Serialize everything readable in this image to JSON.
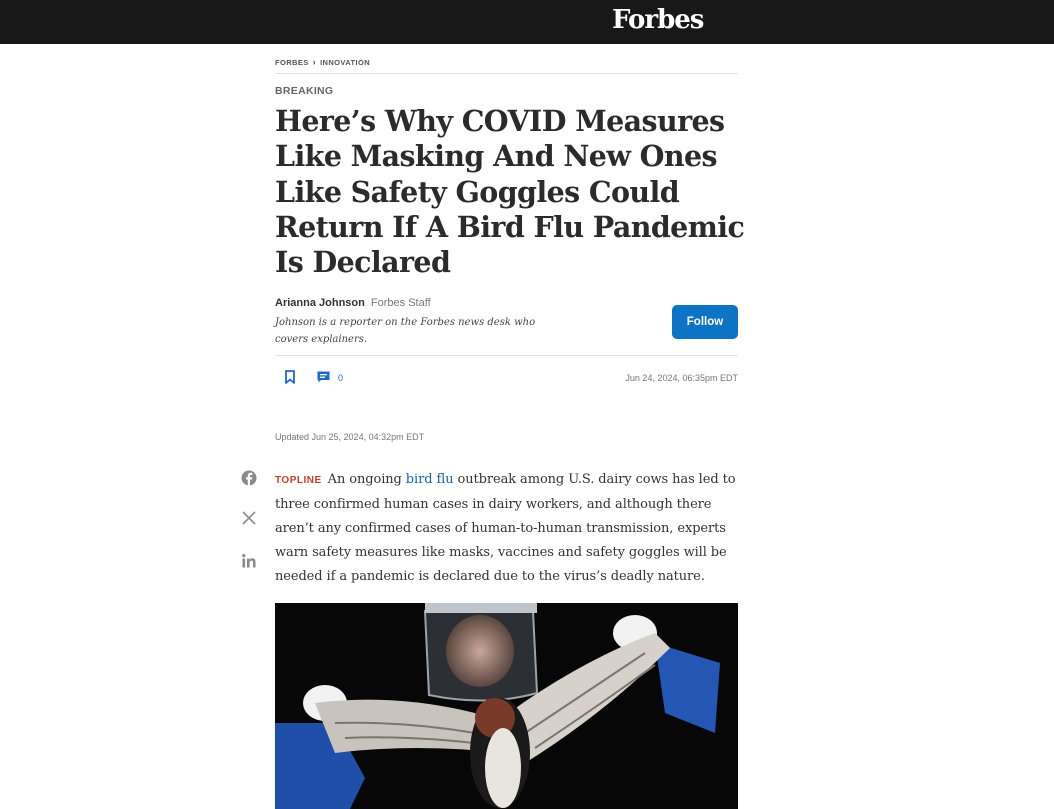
{
  "header": {
    "logo": "Forbes"
  },
  "breadcrumb": {
    "items": [
      "FORBES",
      "INNOVATION"
    ]
  },
  "article": {
    "kicker": "BREAKING",
    "title": "Here’s Why COVID Measures Like Masking And New Ones Like Safety Goggles Could Return If A Bird Flu Pandemic Is Declared",
    "author": {
      "name": "Arianna Johnson",
      "role": "Forbes Staff",
      "bio": "Johnson is a reporter on the Forbes news desk who covers explainers."
    },
    "follow_label": "Follow",
    "comment_count": "0",
    "published": "Jun 24, 2024, 06:35pm EDT",
    "updated": "Updated Jun 25, 2024, 04:32pm EDT",
    "topline_label": "TOPLINE",
    "body_pre": "An ongoing",
    "body_link": "bird flu",
    "body_post": "outbreak among U.S. dairy cows has led to three confirmed human cases in dairy workers, and although there aren’t any confirmed cases of human-to-human transmission, experts warn safety measures like masks, vaccines and safety goggles will be needed if a pandemic is declared due to the virus’s deadly nature."
  },
  "share": {
    "icons": [
      "facebook-icon",
      "x-icon",
      "linkedin-icon"
    ]
  },
  "colors": {
    "topbar": "#181818",
    "accent": "#0d74c5",
    "topline": "#d23b27",
    "link": "#1461a8"
  }
}
